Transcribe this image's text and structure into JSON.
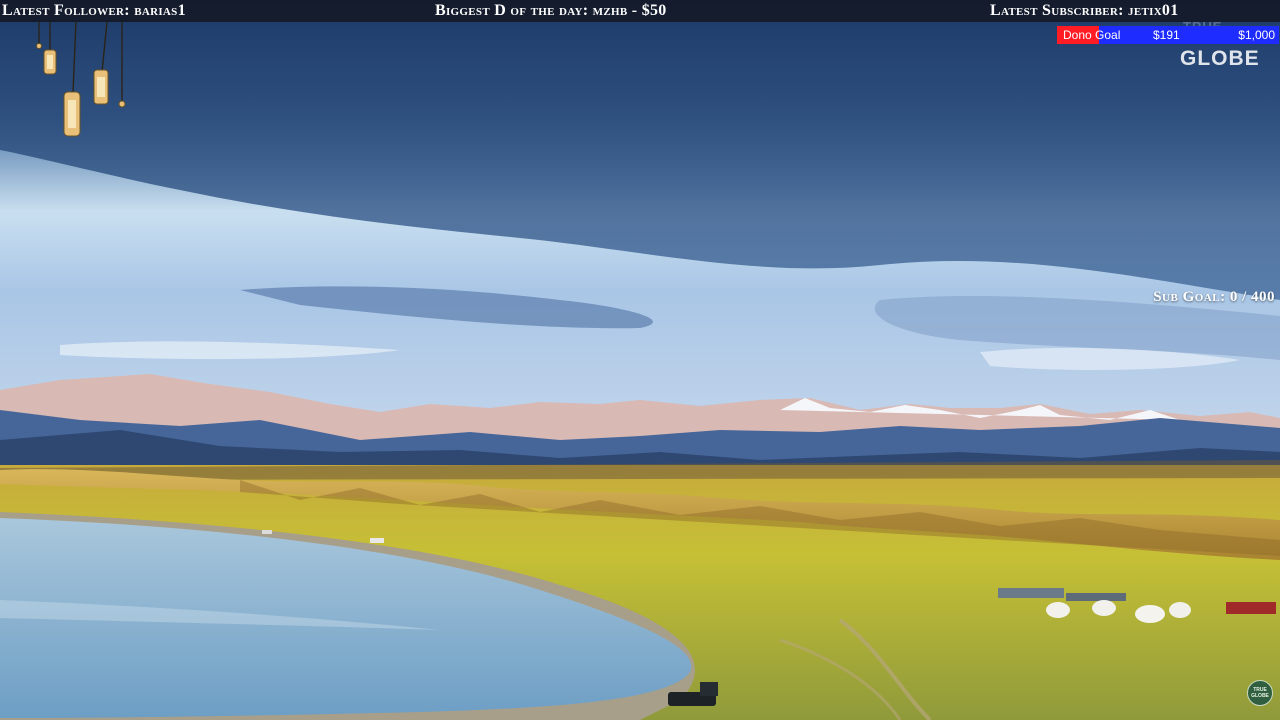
{
  "ticker": {
    "latest_follower": "Latest Follower: barias1",
    "biggest_donation": "Biggest D of the day: mzhb - $50",
    "latest_subscriber": "Latest Subscriber: jetix01"
  },
  "donation_goal": {
    "label": "Dono Goal",
    "current": "$191",
    "target": "$1,000",
    "progress_fraction": 0.191,
    "fill_color": "#ff1c24",
    "track_color": "#1f2cff"
  },
  "sub_goal": {
    "text": "Sub Goal: 0 / 400"
  },
  "watermark": {
    "logo_text": "GLOBE",
    "ghost_text": "TRUE"
  },
  "corner_badge": {
    "text": "TRUE GLOBE"
  },
  "icons": [
    "hanging-lanterns-icon",
    "channel-globe-badge-icon"
  ],
  "scene": {
    "description_colors": {
      "sky_top": "#2e4f80",
      "sky_mid": "#9fc3e6",
      "mountains": "#4a6a9a",
      "grassland": "#c9b73a",
      "lake": "#8fb8d6"
    }
  }
}
